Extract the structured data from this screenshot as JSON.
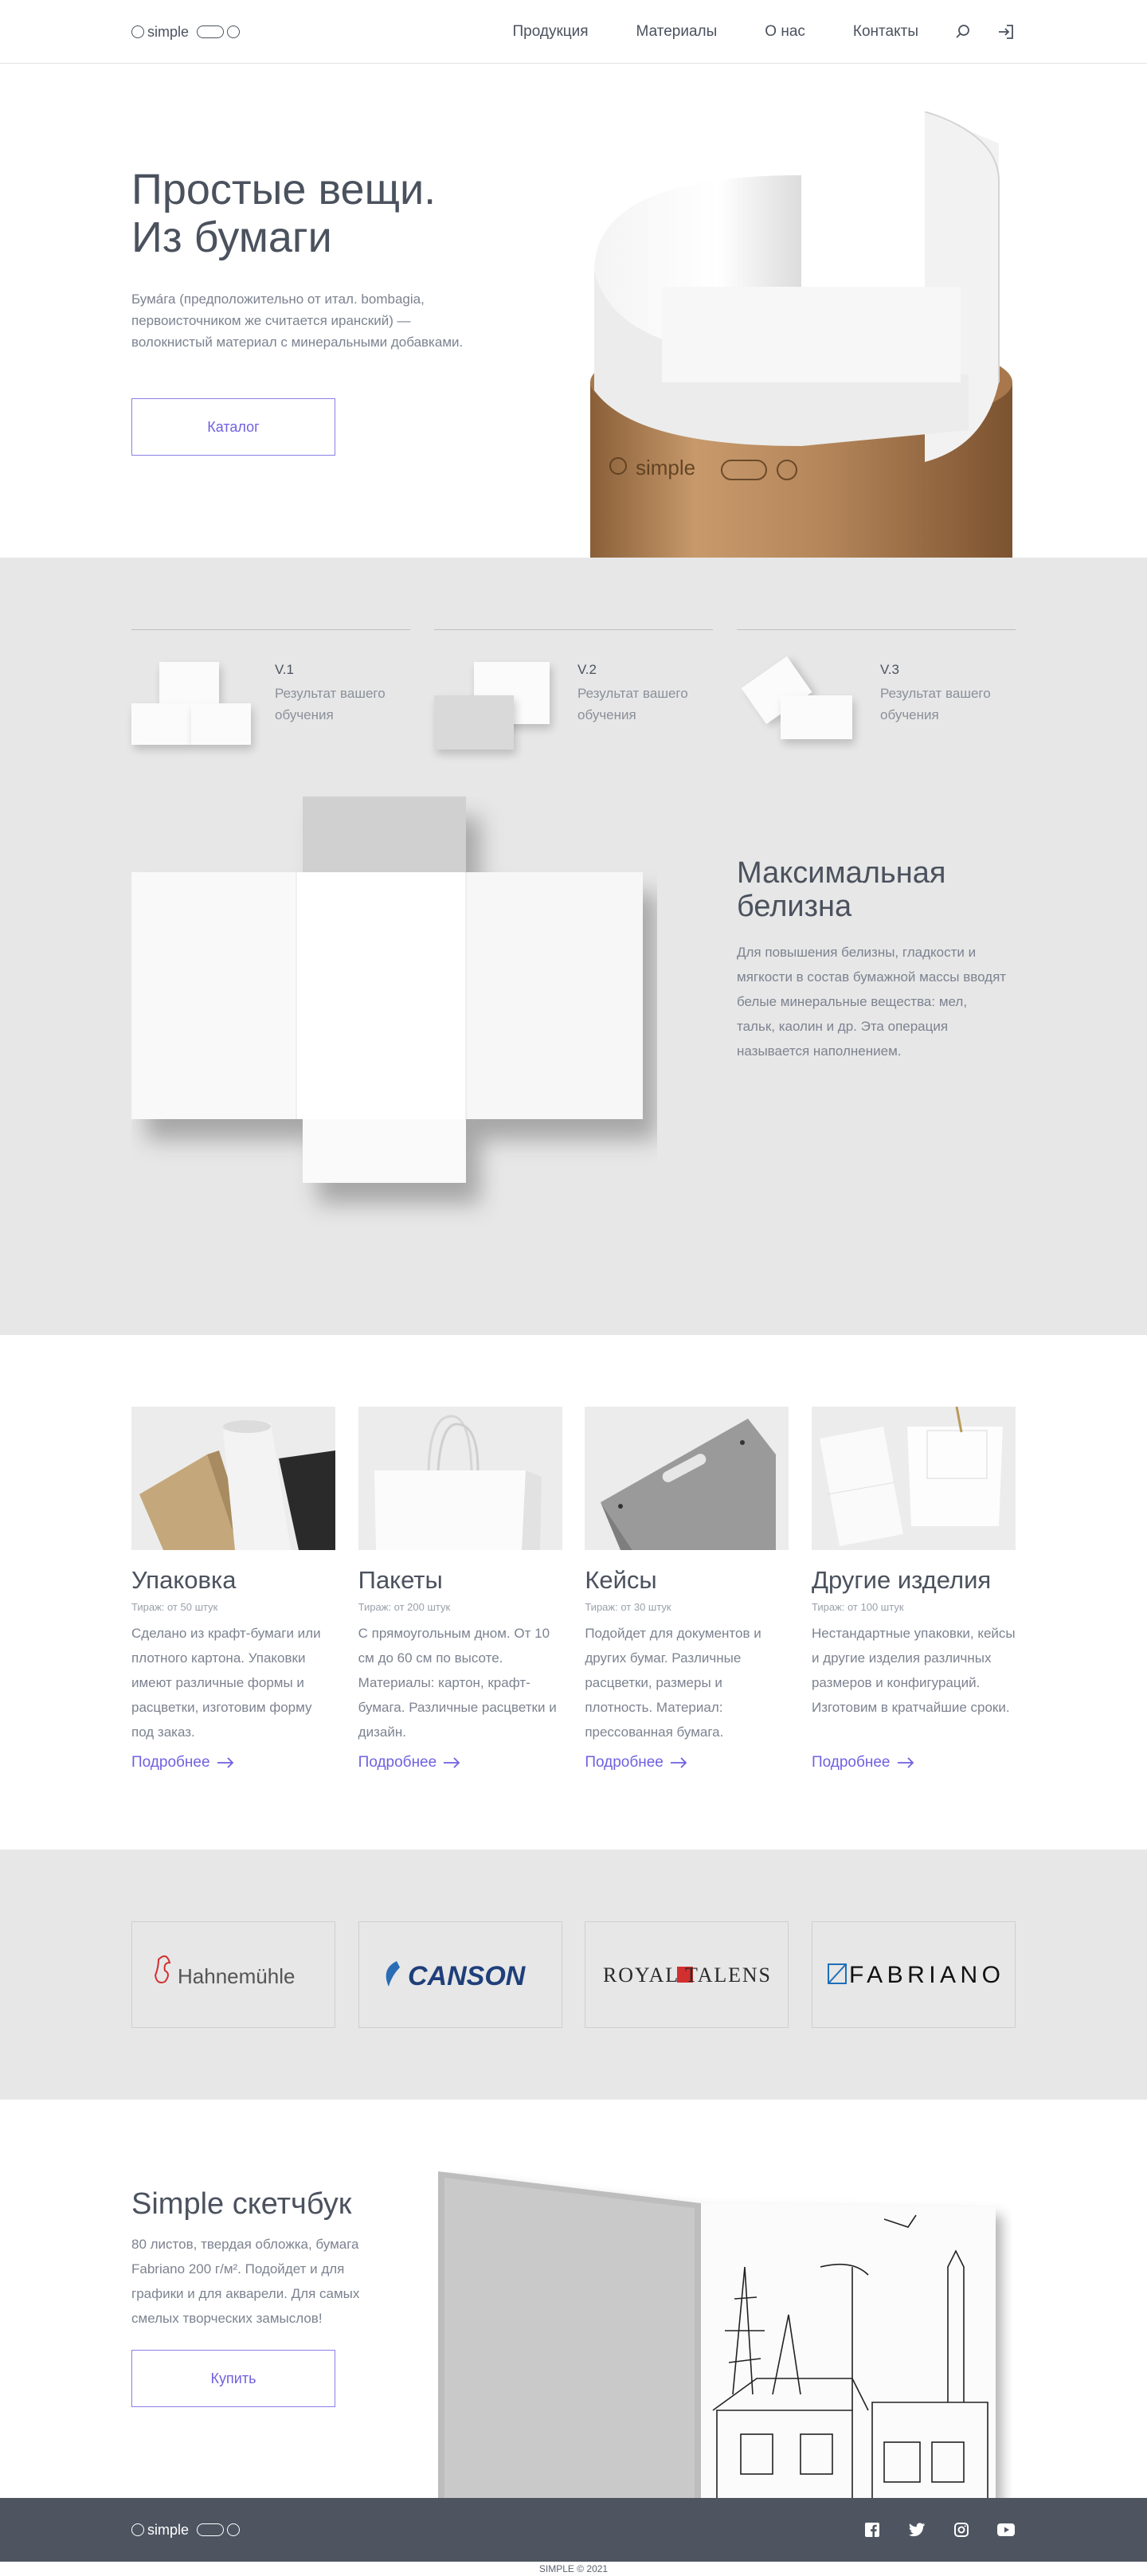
{
  "header": {
    "logo": "simple",
    "nav": [
      "Продукция",
      "Материалы",
      "О нас",
      "Контакты"
    ]
  },
  "hero": {
    "title": "Простые вещи.\nИз бумаги",
    "description": "Бумáга (предположительно от итал. bombagia, первоисточником же считается иранский) — волокнистый материал с минеральными добавками.",
    "button": "Каталог",
    "tube_logo": "simple"
  },
  "versions": [
    {
      "title": "V.1",
      "text": "Результат вашего обучения"
    },
    {
      "title": "V.2",
      "text": "Результат вашего обучения"
    },
    {
      "title": "V.3",
      "text": "Результат вашего обучения"
    }
  ],
  "whiteness": {
    "title": "Максимальная белизна",
    "text": "Для повышения белизны, гладкости и мягкости в состав бумажной массы вводят белые минеральные вещества: мел, тальк, каолин и др. Эта операция называется наполнением."
  },
  "products": [
    {
      "name": "Упаковка",
      "run": "Тираж: от 50 штук",
      "text": "Сделано из крафт-бумаги или плотного картона. Упаковки имеют различные формы и расцветки, изготовим форму под заказ.",
      "more": "Подробнее"
    },
    {
      "name": "Пакеты",
      "run": "Тираж: от 200 штук",
      "text": "С прямоугольным дном. От 10 см до 60 см по высоте. Материалы: картон, крафт-бумага. Различные расцветки и дизайн.",
      "more": "Подробнее"
    },
    {
      "name": "Кейсы",
      "run": "Тираж: от 30 штук",
      "text": "Подойдет для документов и других бумаг. Различные расцветки, размеры и плотность. Материал: прессованная бумага.",
      "more": "Подробнее"
    },
    {
      "name": "Другие изделия",
      "run": "Тираж: от 100 штук",
      "text": "Нестандартные упаковки, кейсы и другие изделия различных размеров и конфигураций. Изготовим в кратчайшие сроки.",
      "more": "Подробнее"
    }
  ],
  "brands": [
    "Hahnemühle",
    "CANSON",
    "ROYAL TALENS",
    "FABRIANO"
  ],
  "sketchbook": {
    "title": "Simple скетчбук",
    "text": "80 листов, твердая обложка, бумага Fabriano 200 г/м². Подойдет и для графики и для акварели. Для самых смелых творческих замыслов!",
    "button": "Купить"
  },
  "footer": {
    "logo": "simple",
    "socials": [
      "facebook-icon",
      "twitter-icon",
      "instagram-icon",
      "youtube-icon"
    ],
    "copyright": "SIMPLE © 2021"
  },
  "colors": {
    "accent": "#6f61e0",
    "text": "#4b525e",
    "grey_bg": "#e7e7e7",
    "footer_bg": "#4e5561"
  }
}
